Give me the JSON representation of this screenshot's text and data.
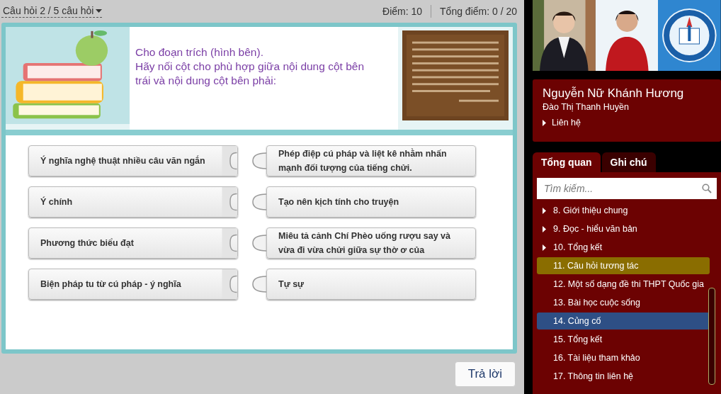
{
  "question_bar": {
    "question_menu": "Câu hỏi 2 / 5 câu hỏi",
    "points": "Điểm: 10",
    "total": "Tổng điểm: 0 / 20"
  },
  "question": {
    "lines": [
      "Cho đoạn trích (hình bên).",
      "Hãy nối cột cho phù hợp giữa nội dung cột bên",
      "trái và nội dung cột bên phải:"
    ]
  },
  "match_left": [
    "Ý nghĩa nghệ thuật nhiều câu văn ngắn",
    "Ý chính",
    "Phương thức biểu đạt",
    "Biện pháp tu từ cú pháp - ý nghĩa"
  ],
  "match_right": [
    "Phép điệp cú pháp và liệt kê nhằm nhấn mạnh đối tượng của tiếng chửi.",
    "Tạo nên kịch tính cho truyện",
    "Miêu tả cảnh Chí Phèo uống rượu say và vừa đi vừa chửi giữa sự thờ ơ của",
    "Tự sự"
  ],
  "submit_button": "Trả lời",
  "presenter": {
    "name": "Nguyễn Nữ Khánh Hương",
    "subtitle": "Đào Thị Thanh Huyền",
    "contact_link": "Liên hệ"
  },
  "tabs": [
    {
      "label": "Tổng quan",
      "selected": true
    },
    {
      "label": "Ghi chú",
      "selected": false
    }
  ],
  "search": {
    "placeholder": "Tìm kiếm..."
  },
  "outline": [
    {
      "label": "8. Giới thiệu chung",
      "expandable": true,
      "selected": false,
      "hovered": false
    },
    {
      "label": "9. Đọc - hiểu văn bản",
      "expandable": true,
      "selected": false,
      "hovered": false
    },
    {
      "label": "10. Tổng kết",
      "expandable": true,
      "selected": false,
      "hovered": false
    },
    {
      "label": "11. Câu hỏi tương tác",
      "expandable": false,
      "selected": true,
      "hovered": false
    },
    {
      "label": "12. Một số dạng đề thi THPT Quốc gia",
      "expandable": false,
      "selected": false,
      "hovered": false
    },
    {
      "label": "13. Bài học cuộc sống",
      "expandable": false,
      "selected": false,
      "hovered": false
    },
    {
      "label": "14. Củng cố",
      "expandable": false,
      "selected": false,
      "hovered": true
    },
    {
      "label": "15. Tổng kết",
      "expandable": false,
      "selected": false,
      "hovered": false
    },
    {
      "label": "16. Tài liệu tham khảo",
      "expandable": false,
      "selected": false,
      "hovered": false
    },
    {
      "label": "17. Thông tin liên hệ",
      "expandable": false,
      "selected": false,
      "hovered": false
    }
  ]
}
